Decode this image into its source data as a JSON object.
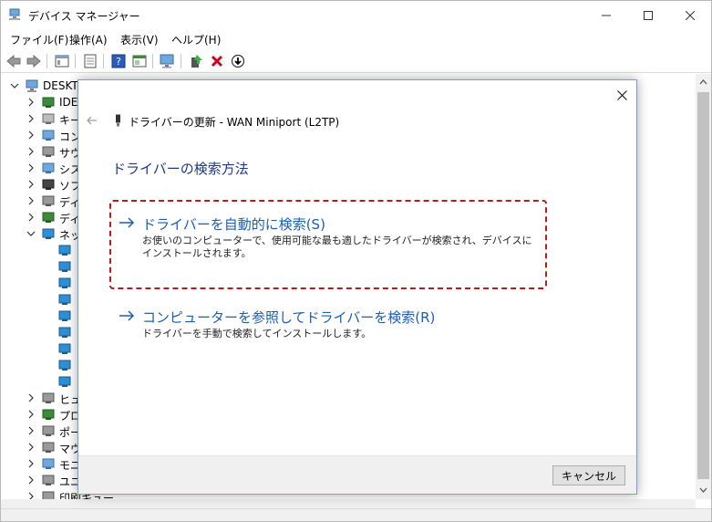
{
  "window": {
    "title": "デバイス マネージャー"
  },
  "menu": [
    "ファイル(F)",
    "操作(A)",
    "表示(V)",
    "ヘルプ(H)"
  ],
  "toolbar": {
    "icons": [
      "back-arrow-icon",
      "forward-arrow-icon",
      "properties-window-icon",
      "printer-list-icon",
      "help-icon",
      "view-icon",
      "monitor-scan-icon",
      "update-driver-icon",
      "uninstall-x-icon",
      "download-arrow-icon"
    ]
  },
  "tree": {
    "root": "DESKTO",
    "items": [
      {
        "label": "IDE",
        "icon": "ide-controller-icon"
      },
      {
        "label": "キー",
        "icon": "keyboard-icon"
      },
      {
        "label": "コン",
        "icon": "computer-icon"
      },
      {
        "label": "サウ",
        "icon": "speaker-icon"
      },
      {
        "label": "シス",
        "icon": "system-device-icon"
      },
      {
        "label": "ソフ",
        "icon": "software-device-icon"
      },
      {
        "label": "ディ",
        "icon": "disk-drive-icon"
      },
      {
        "label": "ディ",
        "icon": "display-adapter-icon"
      },
      {
        "label": "ネッ",
        "icon": "network-adapter-icon"
      },
      {
        "label": "ヒュ",
        "icon": "human-interface-icon"
      },
      {
        "label": "プロ",
        "icon": "processor-icon"
      },
      {
        "label": "ポー",
        "icon": "port-icon"
      },
      {
        "label": "マウ",
        "icon": "mouse-icon"
      },
      {
        "label": "モニ",
        "icon": "monitor-icon"
      },
      {
        "label": "ユニ",
        "icon": "usb-icon"
      },
      {
        "label": "印刷キュー",
        "icon": "print-queue-icon"
      }
    ]
  },
  "dialog": {
    "title": "ドライバーの更新 - WAN Miniport (L2TP)",
    "heading": "ドライバーの検索方法",
    "option1": {
      "title": "ドライバーを自動的に検索(S)",
      "desc": "お使いのコンピューターで、使用可能な最も適したドライバーが検索され、デバイスにインストールされます。"
    },
    "option2": {
      "title": "コンピューターを参照してドライバーを検索(R)",
      "desc": "ドライバーを手動で検索してインストールします。"
    },
    "cancel": "キャンセル"
  },
  "colors": {
    "link": "#1a5fb4",
    "heading": "#1e3a8a",
    "highlight": "#b71c1c",
    "dialog_border": "#7a9ec9"
  }
}
